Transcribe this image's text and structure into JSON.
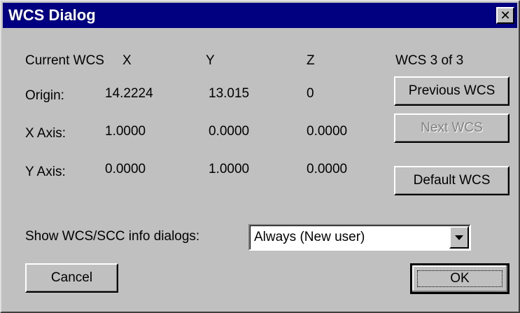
{
  "window": {
    "title": "WCS Dialog",
    "close_glyph": "✕"
  },
  "header": {
    "current_wcs_label": "Current WCS",
    "x_label": "X",
    "y_label": "Y",
    "z_label": "Z",
    "wcs_counter": "WCS 3 of 3"
  },
  "rows": {
    "origin": {
      "label": "Origin:",
      "x": "14.2224",
      "y": "13.015",
      "z": "0"
    },
    "x_axis": {
      "label": "X Axis:",
      "x": "1.0000",
      "y": "0.0000",
      "z": "0.0000"
    },
    "y_axis": {
      "label": "Y Axis:",
      "x": "0.0000",
      "y": "1.0000",
      "z": "0.0000"
    }
  },
  "buttons": {
    "previous": "Previous WCS",
    "next": "Next WCS",
    "default": "Default WCS",
    "cancel": "Cancel",
    "ok": "OK"
  },
  "info_dialogs": {
    "label": "Show WCS/SCC info dialogs:",
    "selected": "Always (New user)"
  },
  "colors": {
    "titlebar": "#000080",
    "face": "#c0c0c0",
    "disabled_text": "#808080"
  },
  "icons": {
    "close": "close-icon",
    "dropdown": "chevron-down-icon"
  }
}
